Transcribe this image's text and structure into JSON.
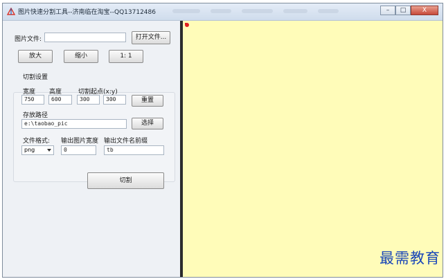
{
  "window": {
    "title": "图片快速分割工具--济南临在淘宝--QQ13712486",
    "controls": {
      "minimize": "–",
      "maximize": "□",
      "close": "X"
    }
  },
  "file": {
    "label": "图片文件:",
    "value": "",
    "open_button": "打开文件..."
  },
  "zoom": {
    "zoom_in": "放大",
    "zoom_out": "缩小",
    "actual": "1: 1"
  },
  "settings": {
    "group_title": "切割设置",
    "width_label": "宽度",
    "height_label": "高度",
    "start_label": "切割起点(x:y)",
    "width_value": "750",
    "height_value": "600",
    "start_x": "300",
    "start_y": "300",
    "reset_button": "重置",
    "path_label": "存放路径",
    "path_value": "e:\\taobao_pic",
    "browse_button": "选择",
    "format_label": "文件格式:",
    "format_value": "png",
    "out_width_label": "输出图片宽度",
    "out_width_value": "0",
    "prefix_label": "输出文件名前缀",
    "prefix_value": "tb"
  },
  "cut_button": "切割",
  "watermark": "最需教育"
}
